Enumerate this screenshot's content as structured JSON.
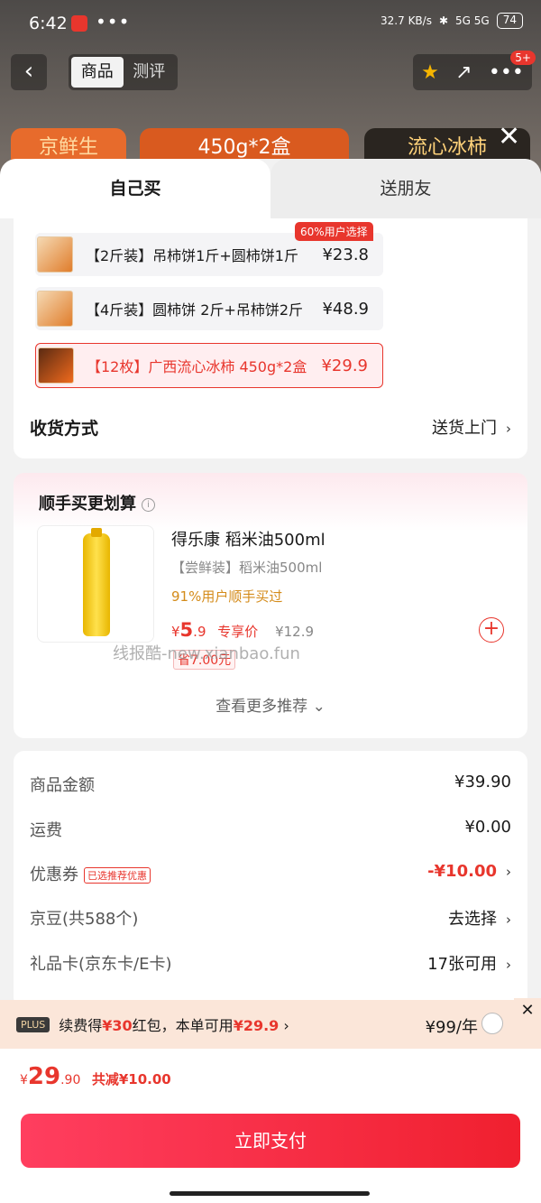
{
  "status": {
    "time": "6:42",
    "dots": "•••",
    "net": "32.7 KB/s",
    "sig": "5G 5G",
    "battery": "74"
  },
  "topbar": {
    "back": "‹",
    "seg_product": "商品",
    "seg_review": "测评",
    "share": "↗",
    "more": "•••",
    "badge": "5+"
  },
  "peek": {
    "a": "京鲜生",
    "b": "450g*2盒",
    "c": "流心冰柿"
  },
  "tabs": {
    "self": "自己买",
    "friend": "送朋友"
  },
  "options": [
    {
      "name": "【2斤装】吊柿饼1斤+圆柿饼1斤",
      "price": "¥23.8",
      "tag": "60%用户选择"
    },
    {
      "name": "【4斤装】圆柿饼 2斤+吊柿饼2斤",
      "price": "¥48.9"
    },
    {
      "name": "【12枚】广西流心冰柿 450g*2盒",
      "price": "¥29.9"
    }
  ],
  "shipping": {
    "label": "收货方式",
    "value": "送货上门"
  },
  "addon": {
    "title": "顺手买更划算",
    "info": "i",
    "name": "得乐康 稻米油500ml",
    "sub": "【尝鲜装】稻米油500ml",
    "buy": "91%用户顺手买过",
    "yen": "¥",
    "price_int": "5",
    "price_dec": ".9",
    "price_note": "专享价",
    "old": "¥12.9",
    "save": "省7.00元",
    "plus": "+",
    "more": "查看更多推荐 ⌄"
  },
  "watermark": "线报酷-new.xianbao.fun",
  "summary": {
    "goods_label": "商品金额",
    "goods_value": "¥39.90",
    "freight_label": "运费",
    "freight_value": "¥0.00",
    "coupon_label": "优惠券",
    "coupon_tag": "已选推荐优惠",
    "coupon_value": "-¥10.00",
    "beans_label": "京豆(共588个)",
    "beans_value": "去选择",
    "gift_label": "礼品卡(京东卡/E卡)",
    "gift_value": "17张可用"
  },
  "plus": {
    "logo": "PLUS",
    "text_a": "续费得",
    "text_b": "¥30",
    "text_c": "红包，本单可用",
    "text_d": "¥29.9",
    "text_e": " ›",
    "year": "¥99/年",
    "close": "✕"
  },
  "pay": {
    "yen": "¥",
    "int": "29",
    "dec": ".90",
    "cut": "共减¥10.00",
    "button": "立即支付"
  }
}
